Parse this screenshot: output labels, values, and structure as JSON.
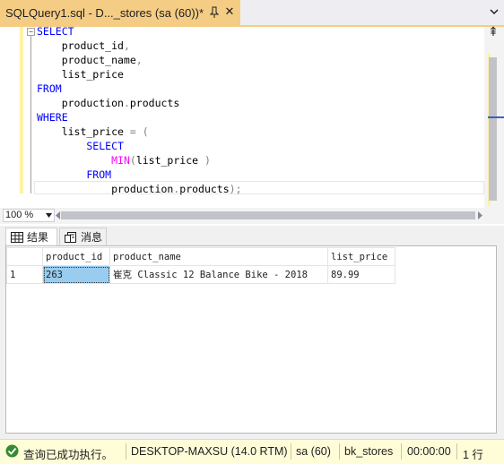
{
  "tab": {
    "title": "SQLQuery1.sql - D..._stores (sa (60))*",
    "close_glyph": "✕"
  },
  "editor": {
    "collapse_glyph": "−",
    "split_glyph": "⇞",
    "lines": [
      [
        {
          "t": "kw",
          "v": "SELECT"
        }
      ],
      [
        {
          "t": "id",
          "v": "    product_id"
        },
        {
          "t": "op",
          "v": ","
        }
      ],
      [
        {
          "t": "id",
          "v": "    product_name"
        },
        {
          "t": "op",
          "v": ","
        }
      ],
      [
        {
          "t": "id",
          "v": "    list_price"
        }
      ],
      [
        {
          "t": "kw",
          "v": "FROM"
        }
      ],
      [
        {
          "t": "id",
          "v": "    production"
        },
        {
          "t": "op",
          "v": "."
        },
        {
          "t": "id",
          "v": "products"
        }
      ],
      [
        {
          "t": "kw",
          "v": "WHERE"
        }
      ],
      [
        {
          "t": "id",
          "v": "    list_price "
        },
        {
          "t": "op",
          "v": "= ("
        }
      ],
      [
        {
          "t": "kw",
          "v": "        SELECT"
        }
      ],
      [
        {
          "t": "id",
          "v": "            "
        },
        {
          "t": "fn",
          "v": "MIN"
        },
        {
          "t": "op",
          "v": "("
        },
        {
          "t": "id",
          "v": "list_price "
        },
        {
          "t": "op",
          "v": ")"
        }
      ],
      [
        {
          "t": "kw",
          "v": "        FROM"
        }
      ],
      [
        {
          "t": "id",
          "v": "            production"
        },
        {
          "t": "op",
          "v": "."
        },
        {
          "t": "id",
          "v": "products"
        },
        {
          "t": "op",
          "v": ");"
        }
      ]
    ]
  },
  "zoom": {
    "value": "100 %"
  },
  "results": {
    "tabs": [
      {
        "label": "结果",
        "icon": "grid-icon"
      },
      {
        "label": "消息",
        "icon": "messages-icon"
      }
    ],
    "columns": [
      "product_id",
      "product_name",
      "list_price"
    ],
    "rows": [
      {
        "rownum": "1",
        "product_id": "263",
        "product_name": "崔克 Classic 12 Balance Bike - 2018",
        "list_price": "89.99"
      }
    ]
  },
  "status": {
    "message": "查询已成功执行。",
    "server": "DESKTOP-MAXSU (14.0 RTM)",
    "user": "sa (60)",
    "database": "bk_stores",
    "elapsed": "00:00:00",
    "rows": "1 行"
  },
  "colors": {
    "tab_active": "#f5cc84",
    "keyword": "#0000ff",
    "function": "#ff00ff",
    "operator": "#808080",
    "status_bg": "#fffdd8",
    "selected_cell": "#99ccee"
  }
}
